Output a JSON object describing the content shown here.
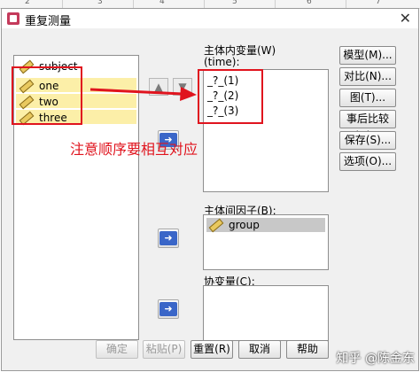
{
  "strip_labels": [
    "2",
    "3",
    "4",
    "5",
    "6",
    "7"
  ],
  "window": {
    "title": "重复测量",
    "close_glyph": "✕"
  },
  "source_list": {
    "items": [
      "subject",
      "one",
      "two",
      "three"
    ]
  },
  "within": {
    "label": "主体内变量(W)",
    "factor": "(time):",
    "items": [
      "_?_(1)",
      "_?_(2)",
      "_?_(3)"
    ]
  },
  "between": {
    "label": "主体间因子(B):",
    "items": [
      "group"
    ]
  },
  "covariates": {
    "label": "协变量(C):"
  },
  "side_buttons": [
    "模型(M)...",
    "对比(N)...",
    "图(T)...",
    "事后比较(H)...",
    "保存(S)...",
    "选项(O)..."
  ],
  "bottom_buttons": {
    "ok": "确定",
    "paste": "粘贴(P)",
    "reset": "重置(R)",
    "cancel": "取消",
    "help": "帮助"
  },
  "annotation": {
    "note": "注意顺序要相互对应",
    "color": "#e0141e"
  },
  "watermark": "知乎 @陈金东",
  "icons": {
    "variable": "ruler-icon",
    "move_right": "arrow-right-icon",
    "up": "arrow-up-icon",
    "down": "arrow-down-icon"
  },
  "colors": {
    "highlight": "#fcefa8",
    "arrow_button": "#3a66c8",
    "selection": "#c8c8c8"
  }
}
